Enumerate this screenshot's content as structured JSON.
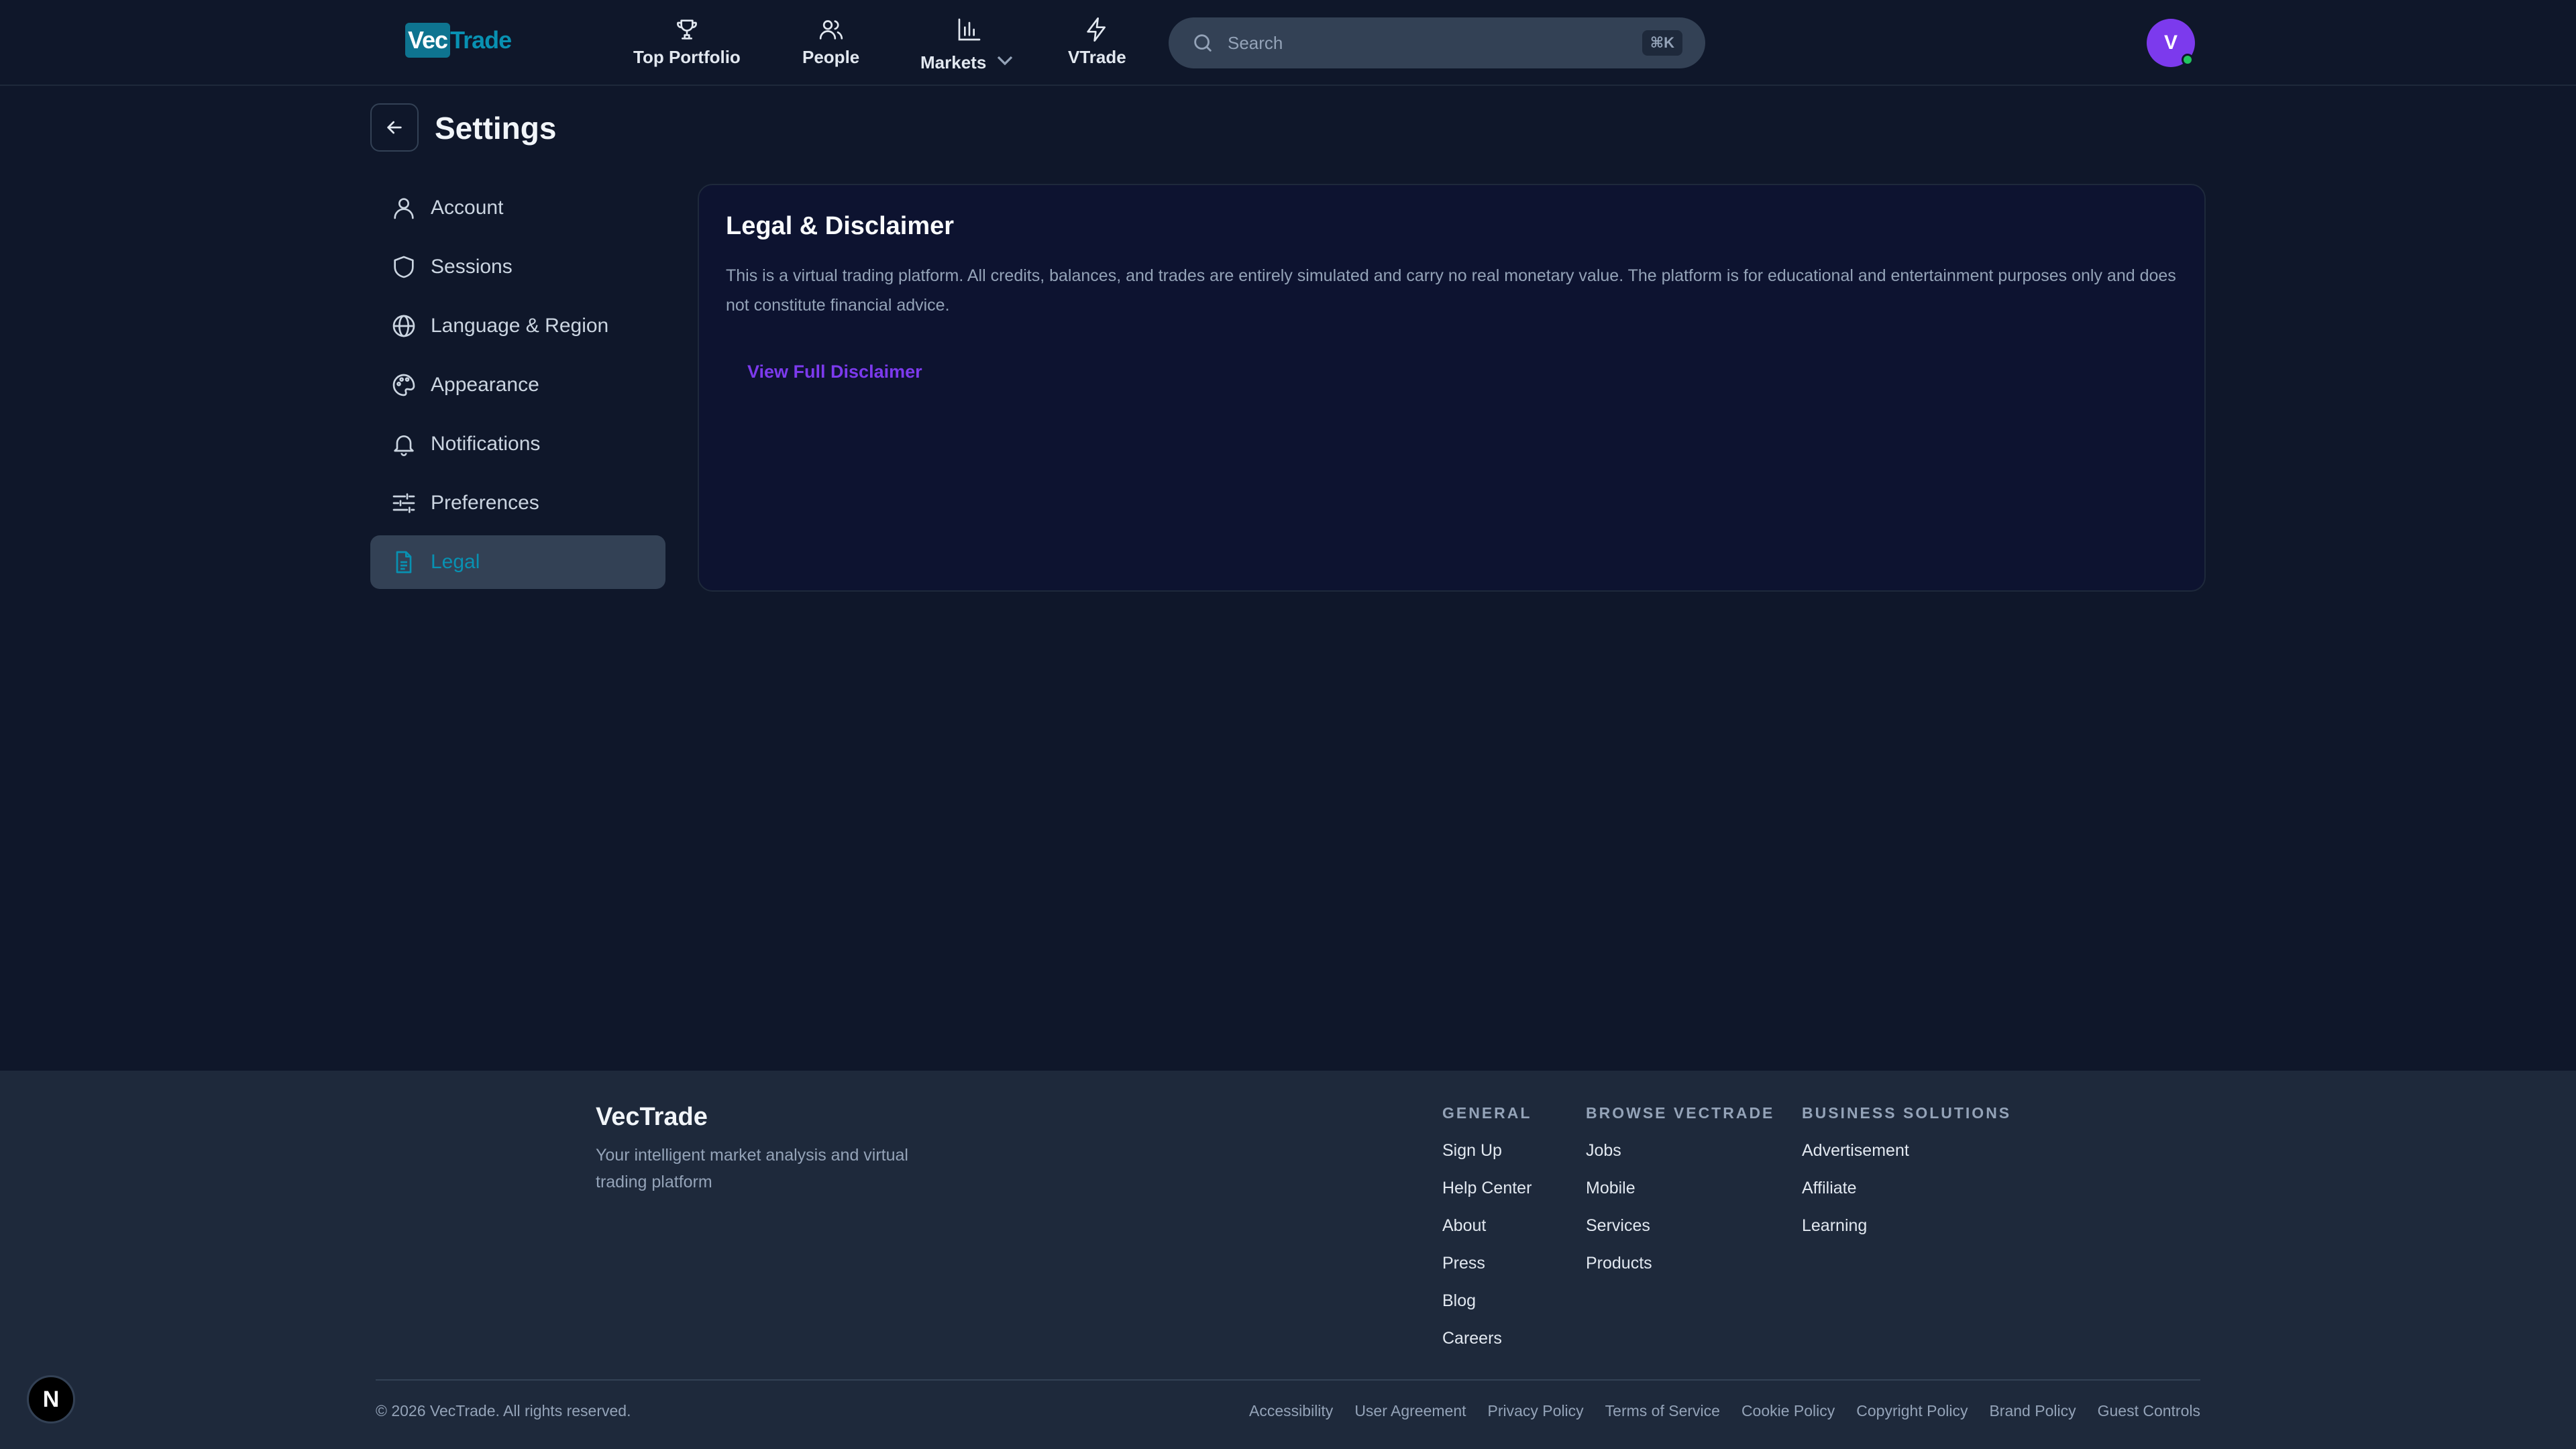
{
  "header": {
    "logo_part1": "Vec",
    "logo_part2": "Trade",
    "nav": [
      {
        "label": "Top Portfolio",
        "icon": "trophy-icon"
      },
      {
        "label": "People",
        "icon": "people-icon"
      },
      {
        "label": "Markets",
        "icon": "bar-chart-icon",
        "has_dropdown": true
      },
      {
        "label": "VTrade",
        "icon": "lightning-icon"
      }
    ],
    "search": {
      "placeholder": "Search",
      "shortcut": "⌘K"
    },
    "avatar_initial": "V"
  },
  "settings": {
    "title": "Settings",
    "sidebar": [
      {
        "label": "Account",
        "icon": "user-icon"
      },
      {
        "label": "Sessions",
        "icon": "shield-icon"
      },
      {
        "label": "Language & Region",
        "icon": "globe-icon"
      },
      {
        "label": "Appearance",
        "icon": "palette-icon"
      },
      {
        "label": "Notifications",
        "icon": "bell-icon"
      },
      {
        "label": "Preferences",
        "icon": "sliders-icon"
      },
      {
        "label": "Legal",
        "icon": "document-icon",
        "active": true
      }
    ],
    "card": {
      "title": "Legal & Disclaimer",
      "text": "This is a virtual trading platform. All credits, balances, and trades are entirely simulated and carry no real monetary value. The platform is for educational and entertainment purposes only and does not constitute financial advice.",
      "link_label": "View Full Disclaimer"
    }
  },
  "footer": {
    "brand": "VecTrade",
    "tagline": "Your intelligent market analysis and virtual trading platform",
    "columns": [
      {
        "heading": "GENERAL",
        "links": [
          "Sign Up",
          "Help Center",
          "About",
          "Press",
          "Blog",
          "Careers"
        ]
      },
      {
        "heading": "BROWSE VECTRADE",
        "links": [
          "Jobs",
          "Mobile",
          "Services",
          "Products"
        ]
      },
      {
        "heading": "BUSINESS SOLUTIONS",
        "links": [
          "Advertisement",
          "Affiliate",
          "Learning"
        ]
      }
    ],
    "copyright": "© 2026 VecTrade. All rights reserved.",
    "legal_links": [
      "Accessibility",
      "User Agreement",
      "Privacy Policy",
      "Terms of Service",
      "Cookie Policy",
      "Copyright Policy",
      "Brand Policy",
      "Guest Controls"
    ]
  },
  "badge": "N",
  "colors": {
    "background": "#0f172a",
    "footer": "#1e293b",
    "accent_cyan": "#0891b2",
    "accent_purple": "#7c3aed",
    "online_green": "#22c55e"
  }
}
